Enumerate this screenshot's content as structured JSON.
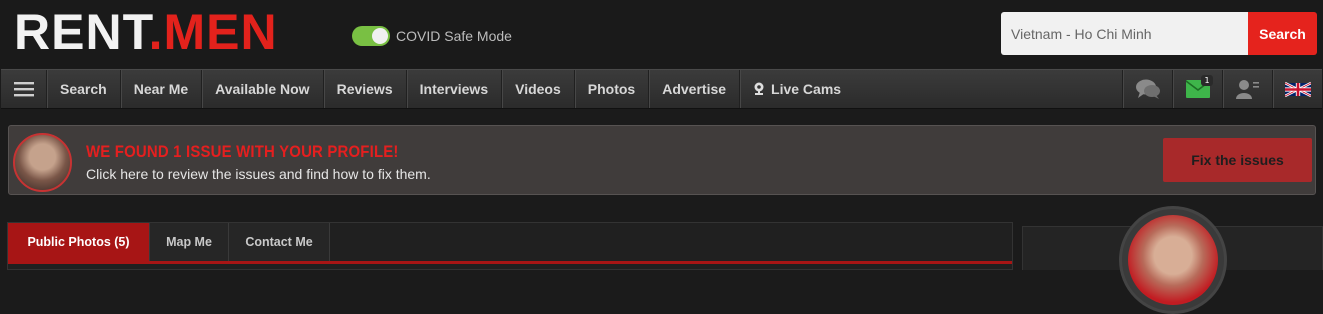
{
  "header": {
    "logo_left": "RENT",
    "logo_dot": ".",
    "logo_right": "MEN",
    "covid_label": "COVID Safe Mode",
    "covid_enabled": true,
    "search_placeholder": "Vietnam - Ho Chi Minh",
    "search_button": "Search"
  },
  "nav": {
    "items": [
      "Search",
      "Near Me",
      "Available Now",
      "Reviews",
      "Interviews",
      "Videos",
      "Photos",
      "Advertise"
    ],
    "live_cams": "Live Cams",
    "messages_badge": "1"
  },
  "alert": {
    "title": "WE FOUND 1 ISSUE WITH YOUR PROFILE!",
    "text": "Click here to review the issues and find how to fix them.",
    "button": "Fix the issues"
  },
  "tabs": {
    "items": [
      "Public Photos (5)",
      "Map Me",
      "Contact Me"
    ]
  },
  "colors": {
    "brand_red": "#e3221c",
    "toggle_green": "#79c043",
    "tab_active": "#a71515",
    "fix_button": "#a8292a"
  }
}
